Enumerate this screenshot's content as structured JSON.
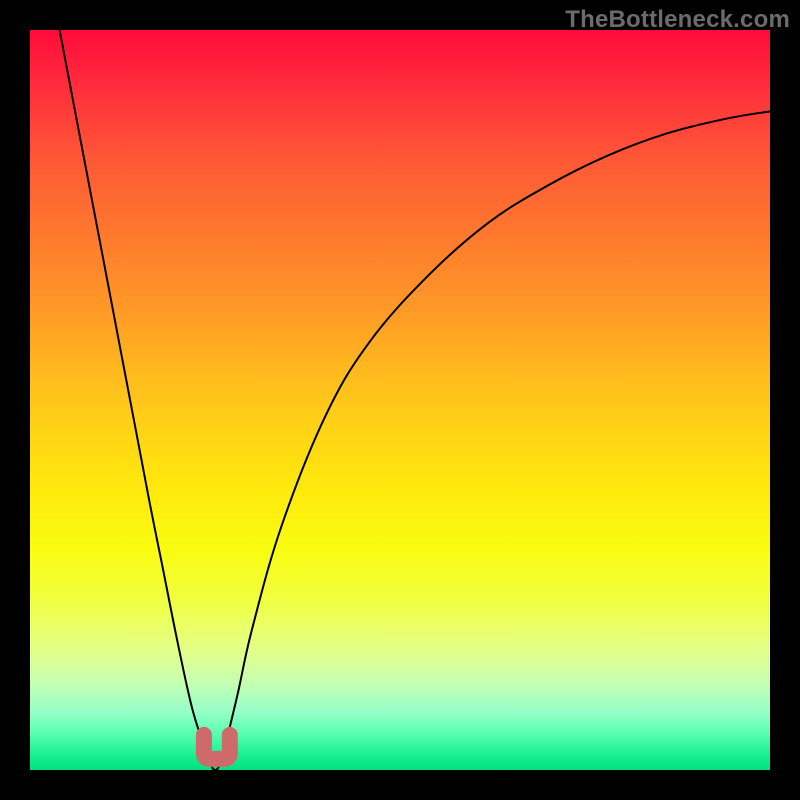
{
  "watermark": "TheBottleneck.com",
  "chart_data": {
    "type": "line",
    "title": "",
    "xlabel": "",
    "ylabel": "",
    "xlim": [
      0,
      100
    ],
    "ylim": [
      0,
      100
    ],
    "grid": false,
    "legend": false,
    "series": [
      {
        "name": "bottleneck-curve",
        "color": "#000000",
        "x": [
          4,
          8,
          12,
          16,
          18,
          20,
          22,
          24,
          25,
          26,
          28,
          30,
          34,
          40,
          46,
          54,
          62,
          70,
          78,
          86,
          94,
          100
        ],
        "y": [
          100,
          79,
          58,
          37,
          27,
          17,
          8,
          2,
          0,
          2,
          10,
          19,
          33,
          48,
          58,
          67,
          74,
          79,
          83,
          86,
          88,
          89
        ]
      }
    ],
    "marker": {
      "name": "minimum-highlight",
      "color": "#cf6a6a",
      "x_range": [
        23.5,
        27
      ],
      "y": 1.5,
      "shape": "u"
    },
    "background_gradient": {
      "direction": "vertical",
      "stops": [
        {
          "pos": 0.0,
          "color": "#ff0b3a"
        },
        {
          "pos": 0.3,
          "color": "#ff7a2e"
        },
        {
          "pos": 0.6,
          "color": "#ffe90d"
        },
        {
          "pos": 0.85,
          "color": "#e6ff80"
        },
        {
          "pos": 1.0,
          "color": "#00e080"
        }
      ]
    }
  }
}
